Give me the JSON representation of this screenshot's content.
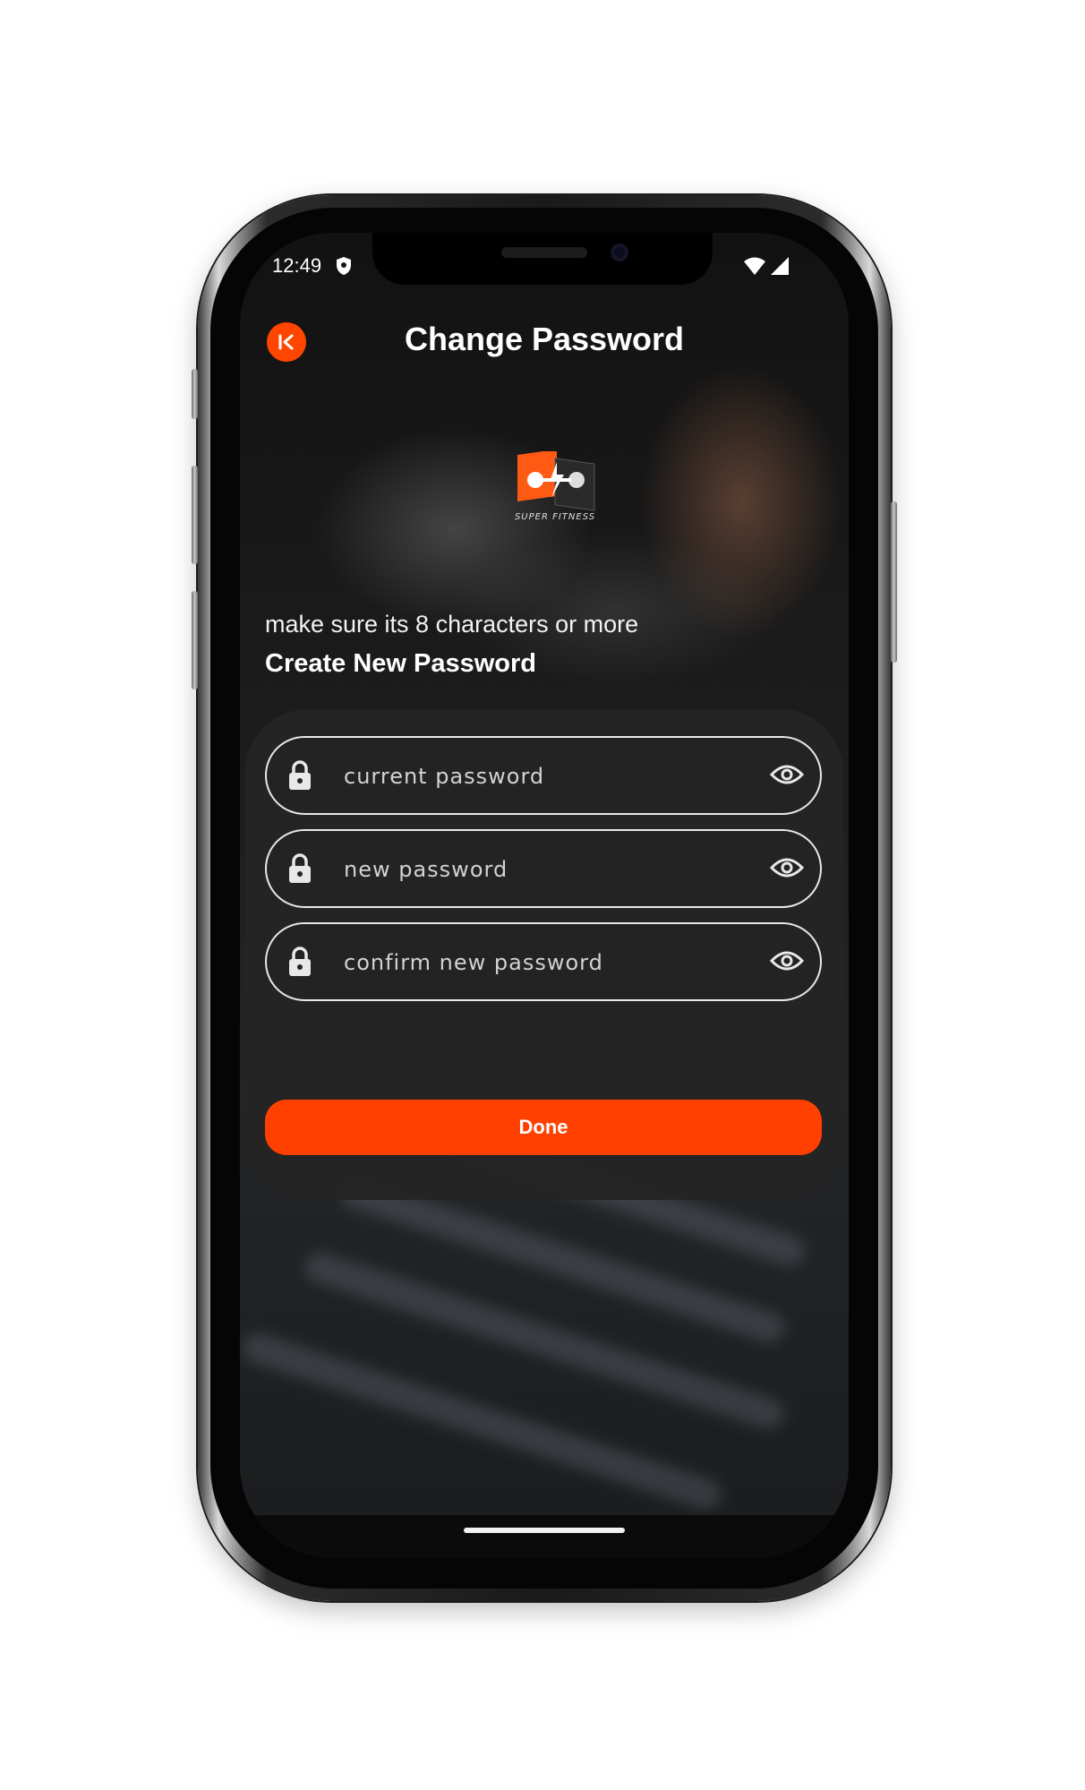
{
  "status_bar": {
    "time": "12:49"
  },
  "header": {
    "title": "Change Password"
  },
  "logo": {
    "text": "SUPER FITNESS"
  },
  "form": {
    "subtitle": "make sure its 8 characters or more",
    "heading": "Create New Password",
    "fields": [
      {
        "placeholder": "current password",
        "value": ""
      },
      {
        "placeholder": "new password",
        "value": ""
      },
      {
        "placeholder": "confirm new password",
        "value": ""
      }
    ],
    "submit_label": "Done"
  },
  "colors": {
    "accent": "#ff4000",
    "background": "#161616",
    "card": "#242424",
    "text": "#ffffff"
  },
  "icons": [
    "back-icon",
    "shield-icon",
    "wifi-icon",
    "signal-icon",
    "lock-icon",
    "eye-icon"
  ]
}
